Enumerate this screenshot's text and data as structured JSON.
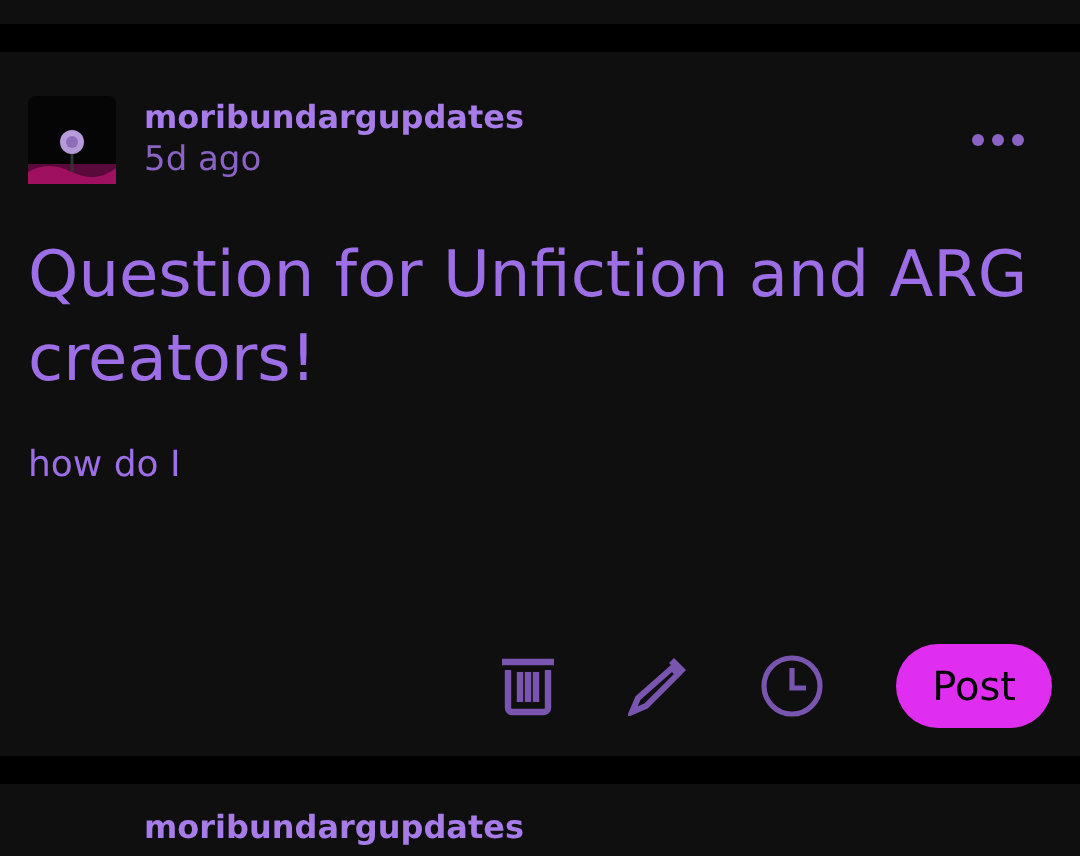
{
  "post": {
    "username": "moribundargupdates",
    "time": "5d ago",
    "title": "Question for Unfiction and ARG creators!",
    "body": "how do I"
  },
  "actions": [
    {
      "kind": "delete"
    },
    {
      "kind": "edit"
    },
    {
      "kind": "schedule"
    }
  ],
  "post_button": "Post",
  "next_post": {
    "username": "moribundargupdates"
  }
}
